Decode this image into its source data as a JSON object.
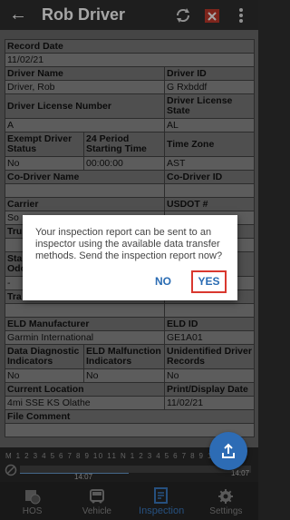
{
  "header": {
    "title": "Rob Driver"
  },
  "report": {
    "record_date_label": "Record Date",
    "record_date": "11/02/21",
    "driver_name_label": "Driver Name",
    "driver_name": "Driver, Rob",
    "driver_id_label": "Driver ID",
    "driver_id": "G Rxbddf",
    "license_number_label": "Driver License Number",
    "license_number": "A",
    "license_state_label": "Driver License State",
    "license_state": "AL",
    "exempt_label": "Exempt Driver Status",
    "exempt": "No",
    "period_label": "24 Period Starting Time",
    "period": "00:00:00",
    "timezone_label": "Time Zone",
    "timezone": "AST",
    "co_driver_name_label": "Co-Driver Name",
    "co_driver_id_label": "Co-Driver ID",
    "carrier_label": "Carrier",
    "carrier": "So",
    "usdot_label": "USDOT #",
    "tru_label": "Tru",
    "sta_label": "Sta",
    "odo_label": "Odo",
    "dash": "-",
    "tra_label": "Tra",
    "eld_manufacturer_label": "ELD Manufacturer",
    "eld_manufacturer": "Garmin International",
    "eld_id_label": "ELD ID",
    "eld_id": "GE1A01",
    "diag_label": "Data Diagnostic Indicators",
    "diag": "No",
    "malfunction_label": "ELD Malfunction Indicators",
    "malfunction": "No",
    "unidentified_label": "Unidentified Driver Records",
    "unidentified": "No",
    "location_label": "Current Location",
    "location": "4mi SSE KS Olathe",
    "print_date_label": "Print/Display Date",
    "print_date": "11/02/21",
    "file_comment_label": "File Comment"
  },
  "timeline": {
    "hours": "M 1 2 3 4 5 6 7 8 9 10 11 N 1 2 3 4 5 6 7 8 9 10 11 M",
    "marker_time": "14:07",
    "end_time": "14:07"
  },
  "dialog": {
    "message": "Your inspection report can be sent to an inspector using the available data transfer methods. Send the inspection report now?",
    "no_label": "NO",
    "yes_label": "YES"
  },
  "nav": {
    "hos": "HOS",
    "vehicle": "Vehicle",
    "inspection": "Inspection",
    "settings": "Settings"
  },
  "colors": {
    "accent": "#2d6cb5",
    "highlight": "#d9382f"
  }
}
